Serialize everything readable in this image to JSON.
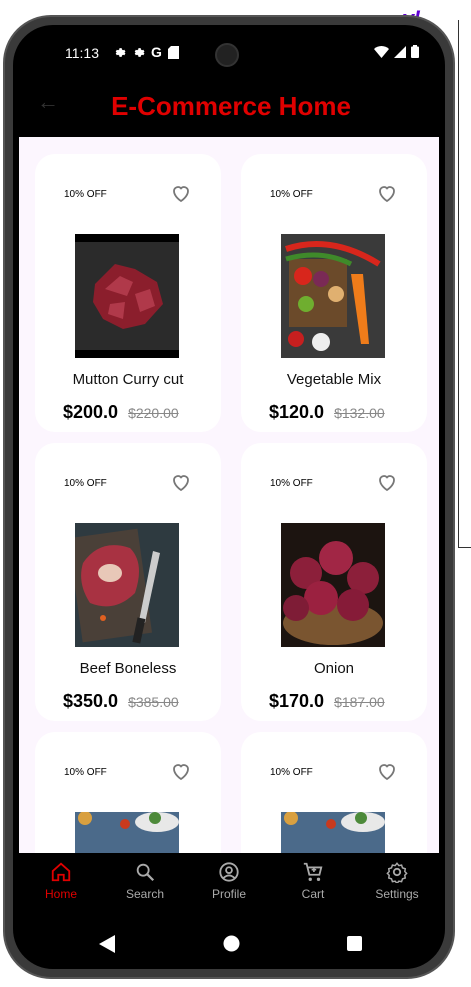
{
  "status": {
    "time": "11:13",
    "icons": [
      "gear-icon",
      "gear-icon",
      "google-icon",
      "sdcard-icon"
    ],
    "right_icons": [
      "wifi-icon",
      "signal-icon",
      "battery-icon"
    ]
  },
  "appbar": {
    "title": "E-Commerce Home"
  },
  "products": [
    {
      "badge": "10% OFF",
      "name": "Mutton Curry cut",
      "price": "$200.0",
      "old_price": "$220.00"
    },
    {
      "badge": "10% OFF",
      "name": "Vegetable Mix",
      "price": "$120.0",
      "old_price": "$132.00"
    },
    {
      "badge": "10% OFF",
      "name": "Beef Boneless",
      "price": "$350.0",
      "old_price": "$385.00"
    },
    {
      "badge": "10% OFF",
      "name": "Onion",
      "price": "$170.0",
      "old_price": "$187.00"
    },
    {
      "badge": "10% OFF",
      "name": "",
      "price": "",
      "old_price": ""
    },
    {
      "badge": "10% OFF",
      "name": "",
      "price": "",
      "old_price": ""
    }
  ],
  "nav": [
    {
      "label": "Home",
      "icon": "home-icon",
      "active": true
    },
    {
      "label": "Search",
      "icon": "search-icon"
    },
    {
      "label": "Profile",
      "icon": "profile-icon"
    },
    {
      "label": "Cart",
      "icon": "cart-icon"
    },
    {
      "label": "Settings",
      "icon": "settings-icon"
    }
  ],
  "colors": {
    "accent": "#e00000",
    "content_bg": "#fcf6fe",
    "bar_bg": "#000000"
  }
}
